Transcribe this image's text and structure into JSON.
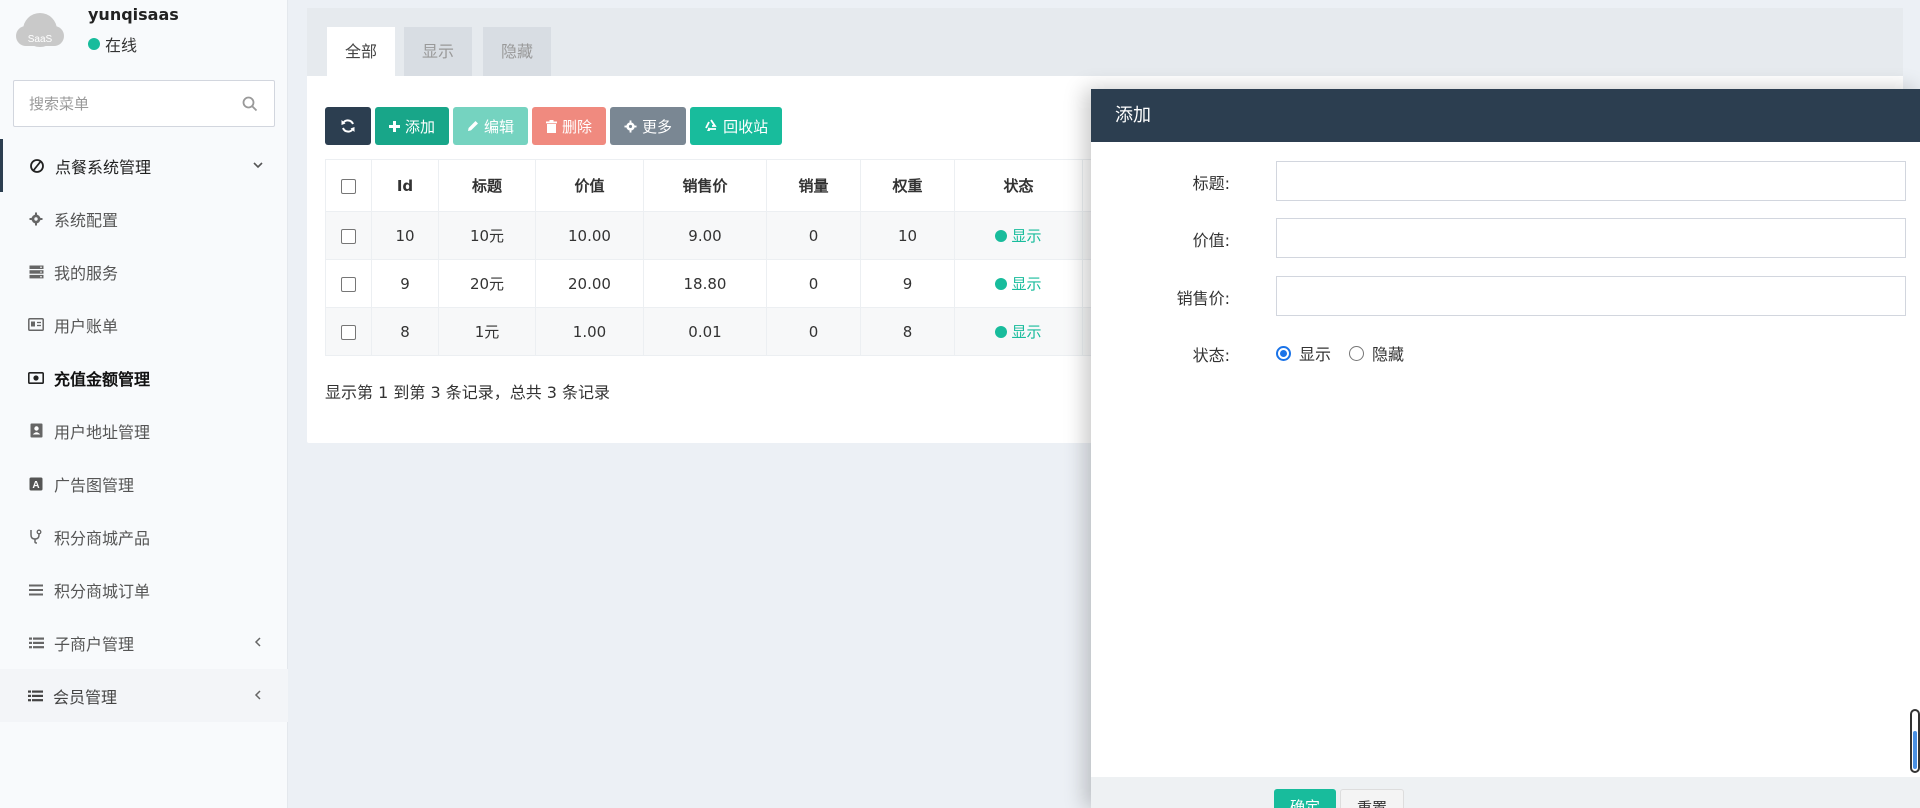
{
  "user": {
    "name": "yunqisaas",
    "status": "在线",
    "avatar_text": "SaaS"
  },
  "search": {
    "placeholder": "搜索菜单"
  },
  "menu": {
    "parent": {
      "label": "点餐系统管理",
      "icon": "circle-arrow-icon"
    },
    "items": [
      {
        "label": "系统配置",
        "icon": "gear-icon"
      },
      {
        "label": "我的服务",
        "icon": "server-icon"
      },
      {
        "label": "用户账单",
        "icon": "id-card-icon"
      },
      {
        "label": "充值金额管理",
        "icon": "money-icon",
        "active": true
      },
      {
        "label": "用户地址管理",
        "icon": "address-book-icon"
      },
      {
        "label": "广告图管理",
        "icon": "font-box-icon"
      },
      {
        "label": "积分商城产品",
        "icon": "stethoscope-icon"
      },
      {
        "label": "积分商城订单",
        "icon": "bars-icon"
      },
      {
        "label": "子商户管理",
        "icon": "list-icon"
      }
    ],
    "member": {
      "label": "会员管理",
      "icon": "list-icon"
    }
  },
  "tabs": [
    "全部",
    "显示",
    "隐藏"
  ],
  "toolbar": {
    "add": "添加",
    "edit": "编辑",
    "delete": "删除",
    "more": "更多",
    "recycle": "回收站"
  },
  "table": {
    "headers": [
      "Id",
      "标题",
      "价值",
      "销售价",
      "销量",
      "权重",
      "状态"
    ],
    "rows": [
      {
        "id": "10",
        "title": "10元",
        "value": "10.00",
        "price": "9.00",
        "sales": "0",
        "weight": "10",
        "status": "显示"
      },
      {
        "id": "9",
        "title": "20元",
        "value": "20.00",
        "price": "18.80",
        "sales": "0",
        "weight": "9",
        "status": "显示"
      },
      {
        "id": "8",
        "title": "1元",
        "value": "1.00",
        "price": "0.01",
        "sales": "0",
        "weight": "8",
        "status": "显示"
      }
    ]
  },
  "pager": {
    "info": "显示第 1 到第 3 条记录，总共 3 条记录"
  },
  "modal": {
    "title": "添加",
    "fields": {
      "title": "标题:",
      "value": "价值:",
      "price": "销售价:",
      "status": "状态:"
    },
    "status_options": [
      "显示",
      "隐藏"
    ],
    "status_selected": "显示",
    "buttons": {
      "ok": "确定",
      "reset": "重置"
    }
  },
  "colors": {
    "accent": "#18bc9c",
    "header": "#2c3e50"
  }
}
